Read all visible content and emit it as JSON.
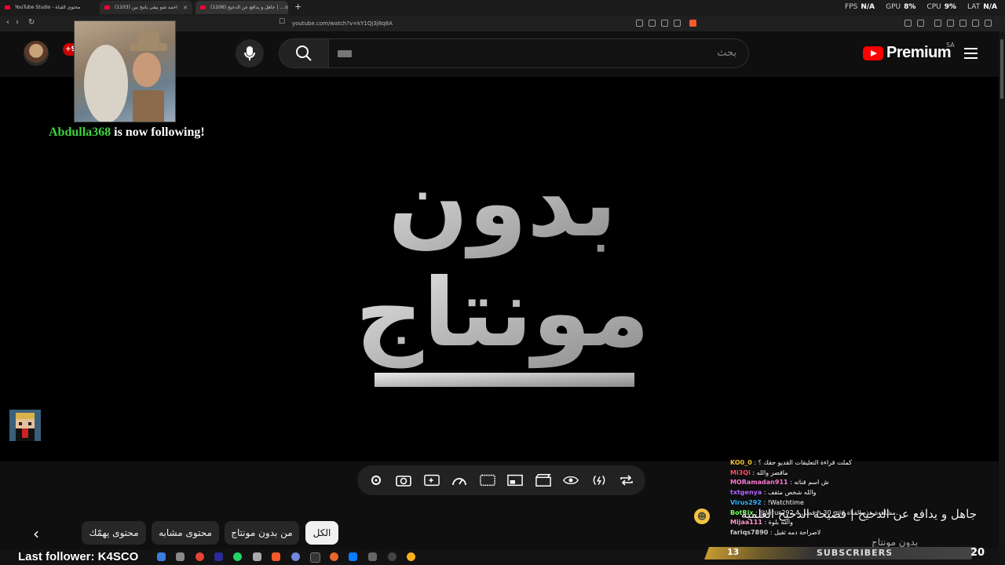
{
  "browser": {
    "tabs": [
      {
        "label": "YouTube Studio - محتوى القناة"
      },
      {
        "label": "(1103) احمد شو بيقى يامخ بين"
      },
      {
        "label": "(1106) جاهل و يدافع عن الدحيح | ..."
      }
    ],
    "url": "youtube.com/watch?v=kY1Qj3j8q8A",
    "stats": [
      {
        "label": "FPS",
        "value": "N/A"
      },
      {
        "label": "GPU",
        "value": "8%"
      },
      {
        "label": "CPU",
        "value": "9%"
      },
      {
        "label": "LAT",
        "value": "N/A"
      }
    ]
  },
  "header": {
    "search_placeholder": "بحث",
    "logo_text": "Premium",
    "region": "SA",
    "notification_count": "+9"
  },
  "overlay": {
    "follow_user": "Abdulla368",
    "follow_text": " is now following!",
    "last_follower_label": "Last follower: K4SCO"
  },
  "video": {
    "title": "جاهل و يدافع عن الدحيح | فضيحة الدحيح العلمية",
    "logo_line1": "بدون",
    "logo_line2": "مونتاج"
  },
  "controls": [
    "settings-icon",
    "screenshot-icon",
    "ai-enhance-icon",
    "speed-icon",
    "subtitles-icon",
    "pip-icon",
    "clapper-icon",
    "eye-icon",
    "audio-icon",
    "loop-icon"
  ],
  "chips": [
    {
      "label": "الكل",
      "active": true
    },
    {
      "label": "من بدون مونتاج",
      "active": false
    },
    {
      "label": "محتوى مشابه",
      "active": false
    },
    {
      "label": "محتوى يهمّك",
      "active": false
    }
  ],
  "chat": [
    {
      "user": "KO0_0",
      "color": "#f1c232",
      "text": " : كملت قراءة التعليقات القديو حقك ؟"
    },
    {
      "user": "Mi3Qi",
      "color": "#ff4d6d",
      "text": " : ماقصر والله"
    },
    {
      "user": "MORamadan911",
      "color": "#ff7ad9",
      "text": " : ش اسم قناته"
    },
    {
      "user": "txtgenya",
      "color": "#b06bff",
      "text": " : والله شخص مثقف"
    },
    {
      "user": "Virus292",
      "color": "#2fb8ff",
      "text": " : !Watchtime"
    },
    {
      "user": "BotRix",
      "color": "#7cff6b",
      "text": " : @Virus292 4 قضى h 30 min مشاهدة هذه القناة"
    },
    {
      "user": "Mijaa111",
      "color": "#ff9bd0",
      "text": " : والله بلوة"
    },
    {
      "user": "fariqs7890",
      "color": "#cfcfcf",
      "text": " : لاصراحة دمه ثقيل"
    }
  ],
  "subscribers": {
    "label": "SUBSCRIBERS",
    "count": "20",
    "left": "13"
  },
  "channel_faint": "بدون مونتاج",
  "colors": {
    "accent": "#ff0000",
    "follow_user": "#3dd23d",
    "chip_active_bg": "#f1f1f1"
  }
}
